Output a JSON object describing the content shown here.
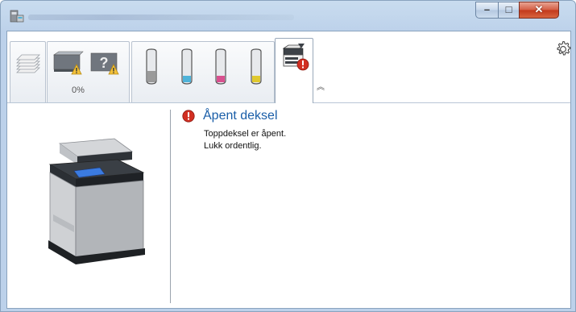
{
  "window": {
    "title_obscured": true,
    "app_icon": "printer-monitor-icon",
    "controls": {
      "minimize": "–",
      "maximize": "□",
      "close": "✕"
    }
  },
  "toolbar": {
    "tabs": [
      {
        "name": "paper",
        "icon": "paper-stack-icon"
      },
      {
        "name": "status",
        "icon": "printer-warning-icon",
        "progress": "0%"
      },
      {
        "name": "toner",
        "icon": "toner-cartridge-icon",
        "cartridges": [
          {
            "color_hint": "#9a9a9a"
          },
          {
            "color_hint": "#4fb3d9"
          },
          {
            "color_hint": "#d9508f"
          },
          {
            "color_hint": "#e0c92e"
          }
        ]
      },
      {
        "name": "device",
        "icon": "device-error-icon",
        "selected": true
      }
    ],
    "collapse_icon": "chevron-up-icon",
    "settings_icon": "gear-icon"
  },
  "status": {
    "title": "Åpent deksel",
    "line1": "Toppdeksel er åpent.",
    "line2": "Lukk ordentlig.",
    "error_color": "#d22f22",
    "title_color": "#1a5ea8"
  },
  "device_image": "multifunction-printer-image"
}
